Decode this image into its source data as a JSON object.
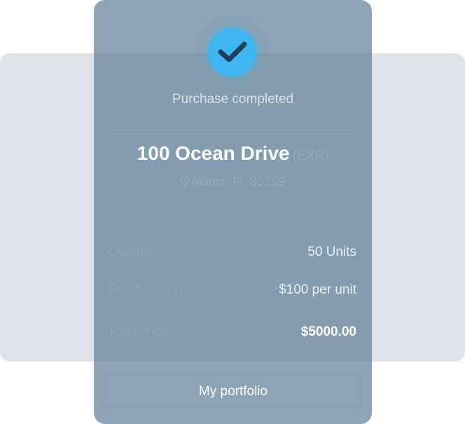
{
  "status": {
    "text": "Purchase completed",
    "icon": "checkmark-icon"
  },
  "property": {
    "name": "100 Ocean Drive",
    "ticker": "(EXR)",
    "location": "Miami, FL 33259",
    "location_icon": "map-pin-icon"
  },
  "details": {
    "quantity_label": "Quantity",
    "quantity_value": "50 Units",
    "purchase_price_label": "Purchase price",
    "purchase_price_value": "$100 per unit",
    "total_price_label": "Total price",
    "total_price_value": "$5000.00"
  },
  "actions": {
    "portfolio_label": "My portfolio"
  },
  "colors": {
    "accent": "#3fb6ef",
    "card": "#5f8198",
    "backdrop": "#dde3e8"
  }
}
